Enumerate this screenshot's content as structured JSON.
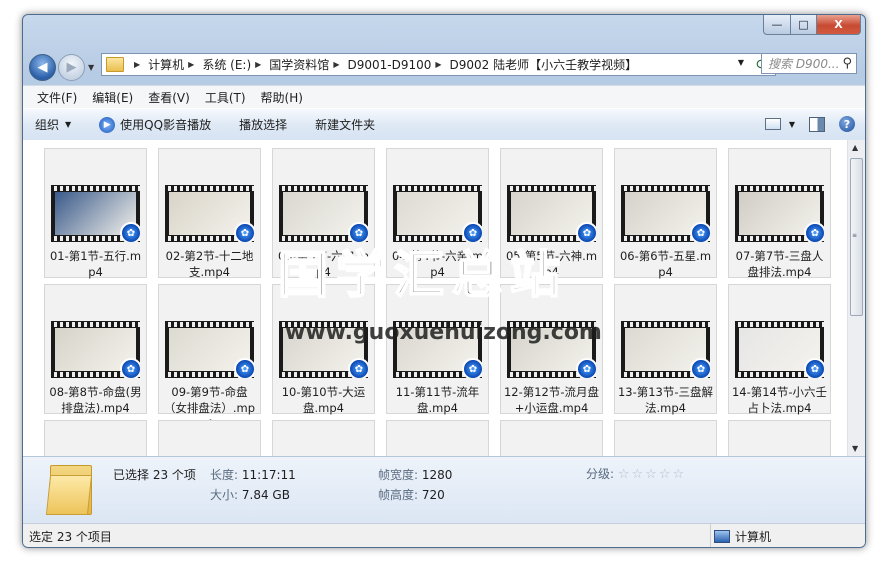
{
  "window": {
    "caption_buttons": {
      "minimize": "—",
      "maximize": "□",
      "close": "X"
    }
  },
  "nav": {
    "breadcrumbs": [
      "计算机",
      "系统 (E:)",
      "国学资料馆",
      "D9001-D9100",
      "D9002 陆老师【小六壬教学视频】"
    ],
    "search_placeholder": "搜索 D900..."
  },
  "menu": [
    "文件(F)",
    "编辑(E)",
    "查看(V)",
    "工具(T)",
    "帮助(H)"
  ],
  "toolbar": {
    "organize": "组织",
    "play_qq": "使用QQ影音播放",
    "play_selection": "播放选择",
    "new_folder": "新建文件夹"
  },
  "files": [
    {
      "name": "01-第1节-五行.mp4",
      "thumb": "#3a5a8a"
    },
    {
      "name": "02-第2节-十二地支.mp4",
      "thumb": "#d8d4c8"
    },
    {
      "name": "03-第3节-六宫.mp4",
      "thumb": "#d9d7d0"
    },
    {
      "name": "04-第4节-六亲.mp4",
      "thumb": "#dcdad2"
    },
    {
      "name": "05-第5节-六神.mp4",
      "thumb": "#d6d4cc"
    },
    {
      "name": "06-第6节-五星.mp4",
      "thumb": "#d4d2ca"
    },
    {
      "name": "07-第7节-三盘人盘排法.mp4",
      "thumb": "#cfcdc5"
    },
    {
      "name": "08-第8节-命盘(男排盘法).mp4",
      "thumb": "#d6d3c9"
    },
    {
      "name": "09-第9节-命盘（女排盘法）.mp4",
      "thumb": "#dddad1"
    },
    {
      "name": "10-第10节-大运盘.mp4",
      "thumb": "#d7d5cd"
    },
    {
      "name": "11-第11节-流年盘.mp4",
      "thumb": "#d9d7cf"
    },
    {
      "name": "12-第12节-流月盘+小运盘.mp4",
      "thumb": "#d5d3cb"
    },
    {
      "name": "13-第13节-三盘解法.mp4",
      "thumb": "#dbd9d1"
    },
    {
      "name": "14-第14节-小六壬占卜法.mp4",
      "thumb": "#e6e6e6"
    }
  ],
  "watermark": {
    "title": "国学汇总站",
    "url": "www.guoxuehuizong.com"
  },
  "details": {
    "selected": "已选择 23 个项",
    "length_label": "长度:",
    "length": "11:17:11",
    "size_label": "大小:",
    "size": "7.84 GB",
    "width_label": "帧宽度:",
    "width": "1280",
    "height_label": "帧高度:",
    "height": "720",
    "rating_label": "分级:",
    "rating": "☆☆☆☆☆"
  },
  "status": {
    "left": "选定 23 个项目",
    "right": "计算机"
  }
}
